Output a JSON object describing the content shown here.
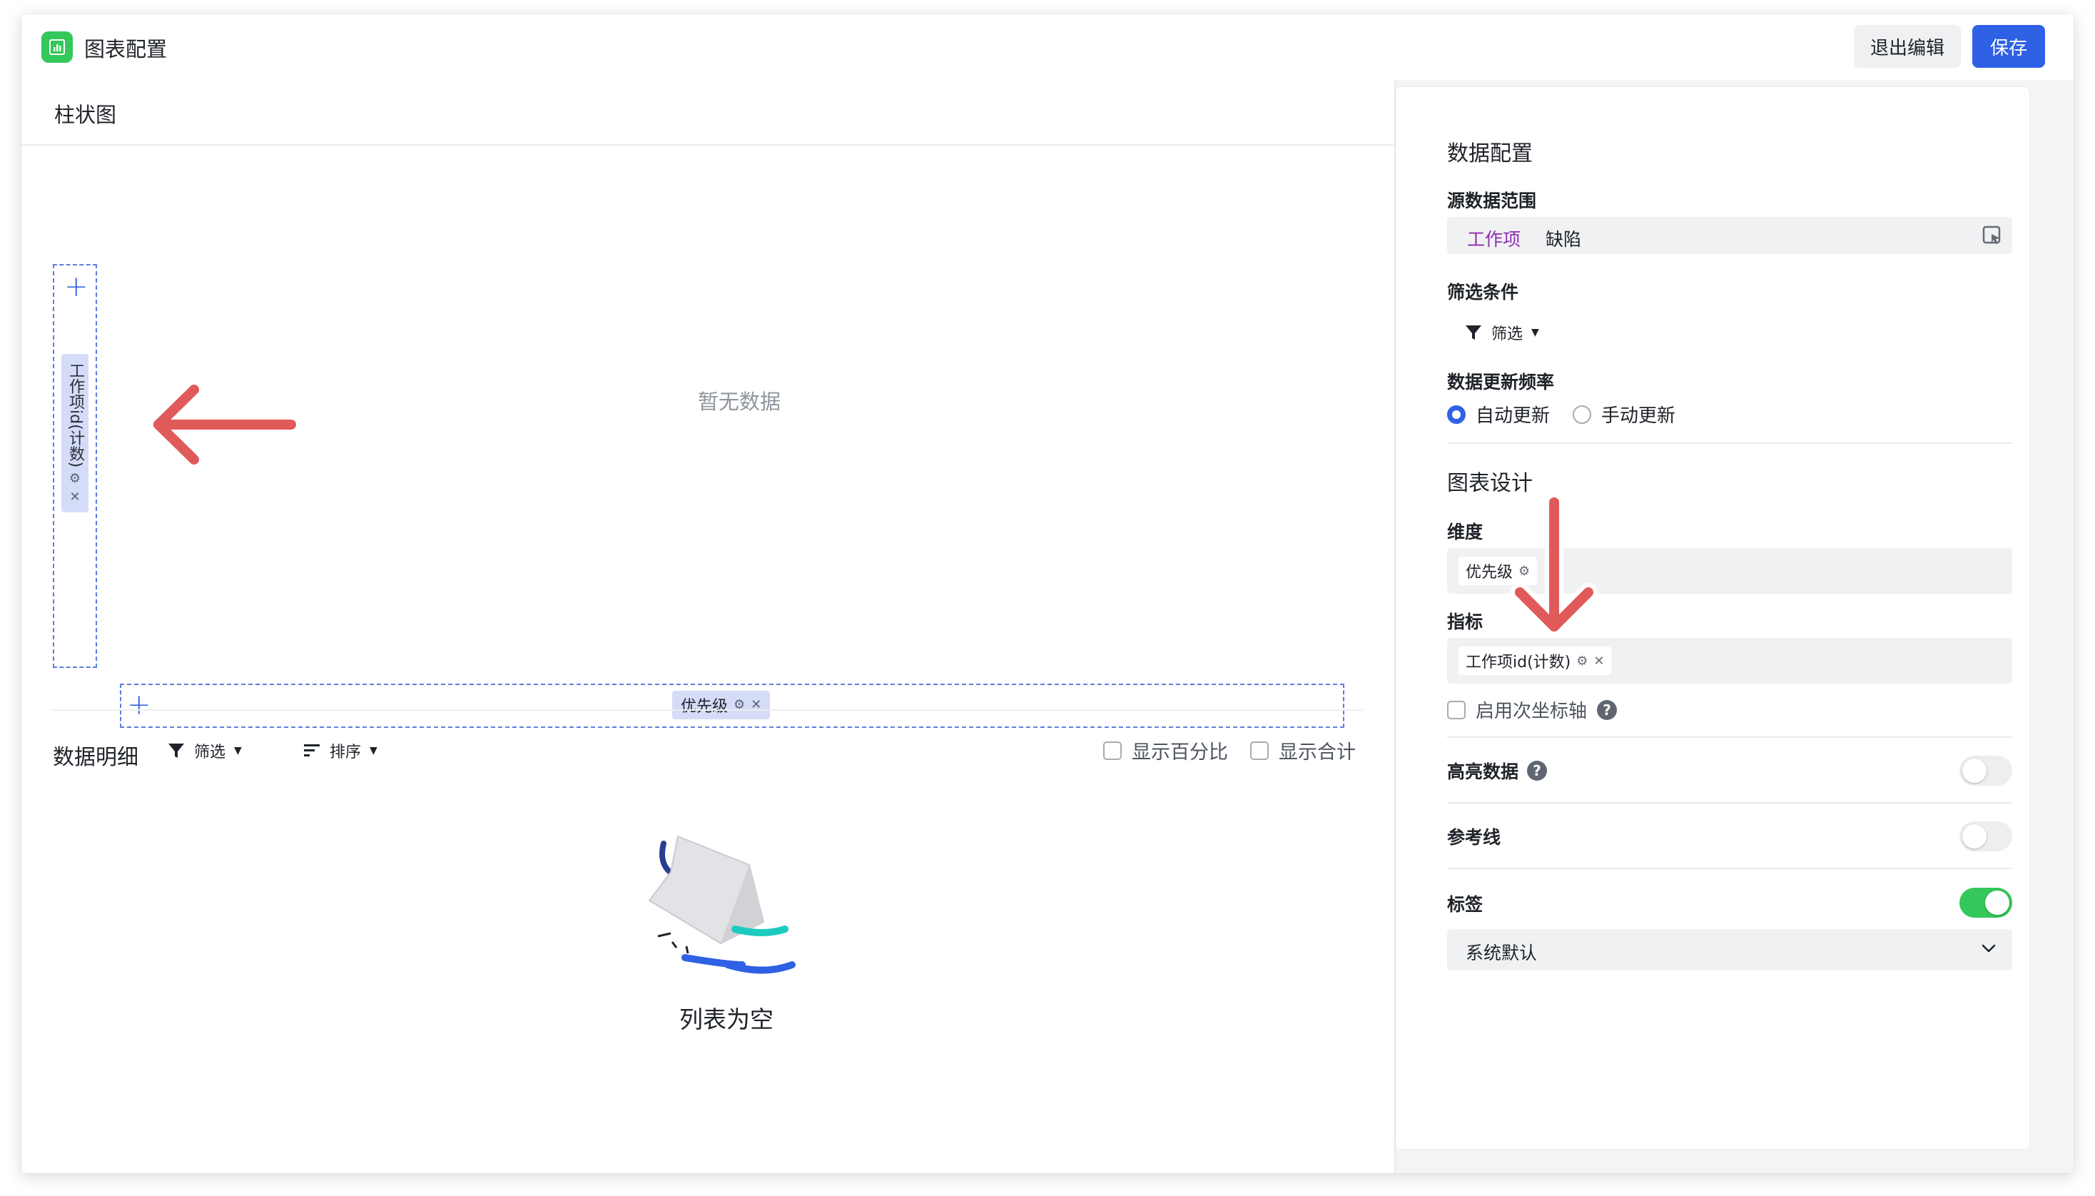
{
  "header": {
    "title": "图表配置",
    "exit_label": "退出编辑",
    "save_label": "保存",
    "app_icon": "bar-chart-icon"
  },
  "canvas": {
    "chart_type": "柱状图",
    "y_axis_field": "工作项id(计数)",
    "x_axis_field": "优先级",
    "no_data": "暂无数据"
  },
  "detail": {
    "title": "数据明细",
    "filter_label": "筛选",
    "sort_label": "排序",
    "show_percent": "显示百分比",
    "show_total": "显示合计",
    "empty_text": "列表为空"
  },
  "panel": {
    "data_config_title": "数据配置",
    "source_label": "源数据范围",
    "source_tag": "工作项",
    "source_value": "缺陷",
    "filter_condition_label": "筛选条件",
    "filter_button": "筛选",
    "refresh_label": "数据更新频率",
    "refresh_auto": "自动更新",
    "refresh_manual": "手动更新",
    "refresh_selected": "自动更新",
    "chart_design_title": "图表设计",
    "dimension_label": "维度",
    "dimension_value": "优先级",
    "metric_label": "指标",
    "metric_value": "工作项id(计数)",
    "secondary_axis": "启用次坐标轴",
    "highlight_label": "高亮数据",
    "highlight_on": false,
    "reference_label": "参考线",
    "reference_on": false,
    "tag_label": "标签",
    "tag_on": true,
    "tag_select_value": "系统默认"
  },
  "colors": {
    "primary": "#2e61e4",
    "toggle_on": "#34c759",
    "source_tag": "#8e2db3",
    "annotation_arrow": "#e05a5a"
  }
}
